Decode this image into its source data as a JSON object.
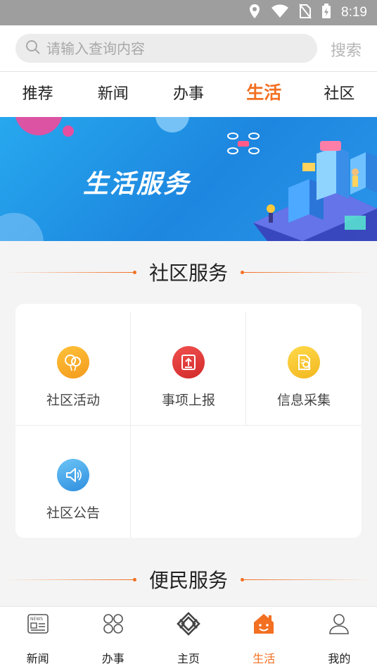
{
  "status_bar": {
    "time": "8:19",
    "icons": [
      "location-icon",
      "wifi-icon",
      "no-sim-icon",
      "battery-charging-icon"
    ]
  },
  "search": {
    "placeholder": "请输入查询内容",
    "button_label": "搜索"
  },
  "tabs": [
    {
      "label": "推荐",
      "active": false
    },
    {
      "label": "新闻",
      "active": false
    },
    {
      "label": "办事",
      "active": false
    },
    {
      "label": "生活",
      "active": true
    },
    {
      "label": "社区",
      "active": false
    }
  ],
  "banner": {
    "title": "生活服务"
  },
  "community_section": {
    "title": "社区服务",
    "items": [
      {
        "label": "社区活动",
        "icon": "balloon-icon",
        "color": "#f7a823"
      },
      {
        "label": "事项上报",
        "icon": "upload-report-icon",
        "color": "#e53935"
      },
      {
        "label": "信息采集",
        "icon": "document-search-icon",
        "color": "#f5c62a"
      },
      {
        "label": "社区公告",
        "icon": "speaker-icon",
        "color": "#3aa0e6"
      }
    ]
  },
  "convenience_section": {
    "title": "便民服务"
  },
  "bottom_nav": [
    {
      "label": "新闻",
      "icon": "news-icon",
      "active": false
    },
    {
      "label": "办事",
      "icon": "grid-icon",
      "active": false
    },
    {
      "label": "主页",
      "icon": "home-logo-icon",
      "active": false
    },
    {
      "label": "生活",
      "icon": "house-smile-icon",
      "active": true
    },
    {
      "label": "我的",
      "icon": "user-icon",
      "active": false
    }
  ],
  "colors": {
    "accent": "#f36f21",
    "banner": "#1d86df"
  }
}
